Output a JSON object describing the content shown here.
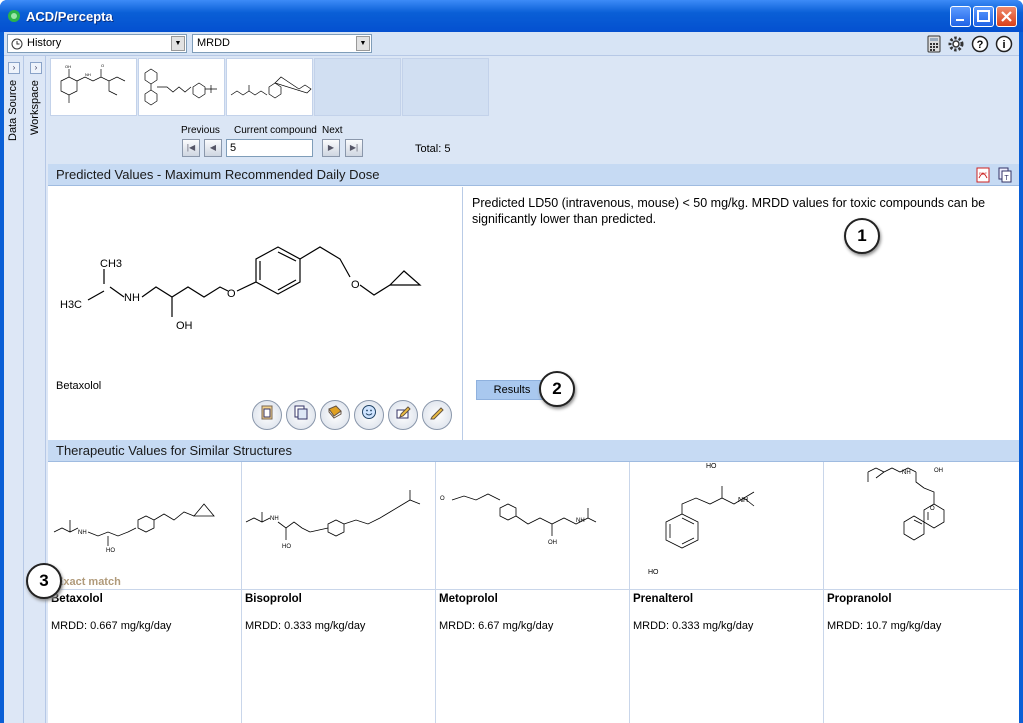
{
  "window": {
    "title": "ACD/Percepta"
  },
  "toolbar": {
    "history_combo": "History",
    "module_combo": "MRDD",
    "icons": [
      "calculator-icon",
      "gear-icon",
      "help-icon",
      "info-icon"
    ]
  },
  "side_tabs": [
    "Data Source",
    "Workspace"
  ],
  "navigation": {
    "previous_label": "Previous",
    "current_label": "Current compound",
    "next_label": "Next",
    "current_value": "5",
    "total": "Total: 5"
  },
  "predicted": {
    "header": "Predicted Values - Maximum Recommended Daily Dose",
    "compound_name": "Betaxolol",
    "note": "Predicted LD50 (intravenous, mouse) < 50 mg/kg. MRDD values for toxic compounds can be significantly lower than predicted.",
    "results_button": "Results",
    "callouts": [
      "1",
      "2",
      "3"
    ],
    "atom_labels": {
      "ch3": "CH3",
      "h3c": "H3C",
      "nh": "NH",
      "oh": "OH",
      "o1": "O",
      "o2": "O"
    }
  },
  "similar": {
    "header": "Therapeutic Values for Similar Structures",
    "exact_match": "Exact match",
    "items": [
      {
        "name": "Betaxolol",
        "value": "MRDD: 0.667 mg/kg/day"
      },
      {
        "name": "Bisoprolol",
        "value": "MRDD: 0.333 mg/kg/day"
      },
      {
        "name": "Metoprolol",
        "value": "MRDD: 6.67 mg/kg/day"
      },
      {
        "name": "Prenalterol",
        "value": "MRDD: 0.333 mg/kg/day"
      },
      {
        "name": "Propranolol",
        "value": "MRDD: 10.7 mg/kg/day"
      }
    ]
  },
  "colors": {
    "titlebar": "#0a5fd6",
    "header": "#c6daf3",
    "panel": "#dbe6f5"
  }
}
